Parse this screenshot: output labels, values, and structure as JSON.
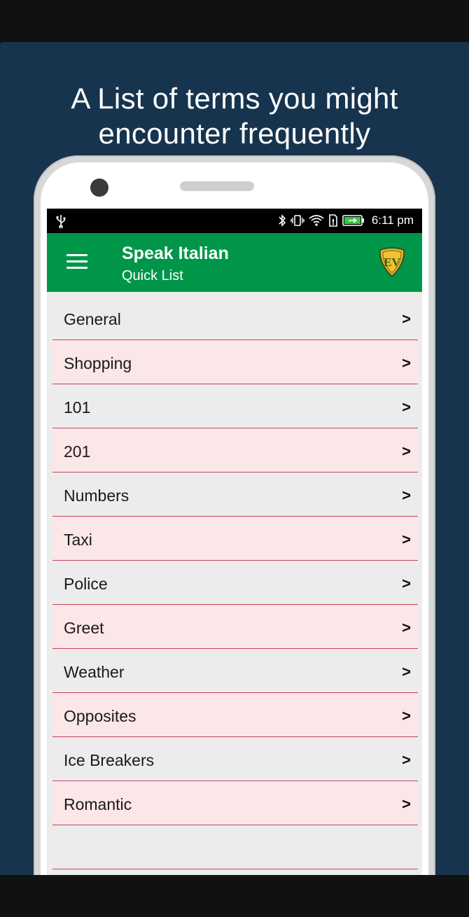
{
  "promo": {
    "headline": "A List of terms you might\nencounter frequently"
  },
  "status_bar": {
    "time": "6:11 pm",
    "icons": [
      "usb-icon",
      "bluetooth-icon",
      "vibrate-icon",
      "wifi-icon",
      "sim-icon",
      "battery-icon"
    ]
  },
  "app_bar": {
    "title": "Speak Italian",
    "subtitle": "Quick List",
    "logo_text": "EV",
    "color": "#00964a"
  },
  "list": {
    "chevron": ">",
    "items": [
      {
        "label": "General"
      },
      {
        "label": "Shopping"
      },
      {
        "label": "101"
      },
      {
        "label": "201"
      },
      {
        "label": "Numbers"
      },
      {
        "label": "Taxi"
      },
      {
        "label": "Police"
      },
      {
        "label": "Greet"
      },
      {
        "label": "Weather"
      },
      {
        "label": "Opposites"
      },
      {
        "label": "Ice Breakers"
      },
      {
        "label": "Romantic"
      },
      {
        "label": ""
      }
    ]
  },
  "colors": {
    "background": "#17344f",
    "row_grey": "#ececec",
    "row_pink": "#fbe6e8",
    "divider": "#c8415a"
  }
}
